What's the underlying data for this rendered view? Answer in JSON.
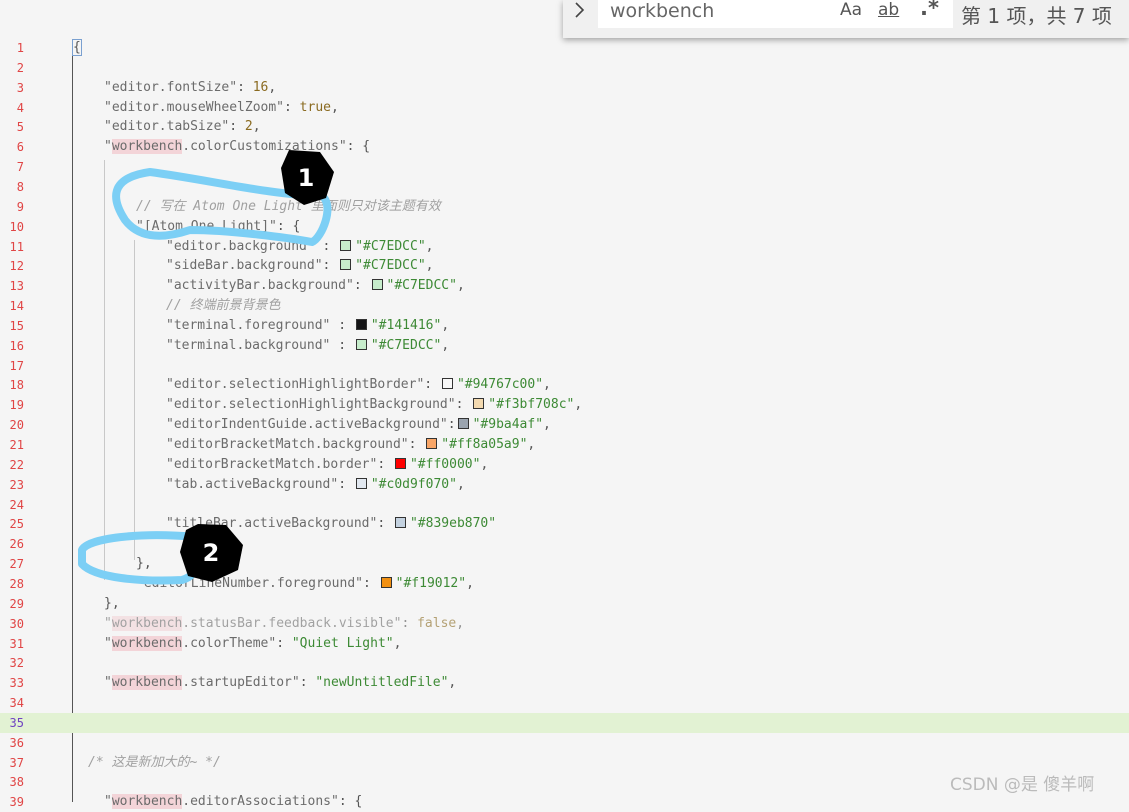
{
  "find": {
    "query": "workbench",
    "match_case_label": "Aa",
    "whole_word_label": "ab",
    "regex_label": ".*",
    "match_count": "第 1 项，共 7 项"
  },
  "annotations": [
    "1",
    "2"
  ],
  "watermark": "CSDN @是 傻羊啊",
  "lines": [
    {
      "n": "1",
      "indent": 72,
      "tokens": [
        {
          "t": "{",
          "c": "pun bracket"
        }
      ]
    },
    {
      "n": "2",
      "indent": 104,
      "tokens": []
    },
    {
      "n": "3",
      "indent": 104,
      "tokens": [
        {
          "t": "\"editor.fontSize\"",
          "c": "key"
        },
        {
          "t": ": ",
          "c": "pun"
        },
        {
          "t": "16",
          "c": "num"
        },
        {
          "t": ",",
          "c": "pun"
        }
      ]
    },
    {
      "n": "4",
      "indent": 104,
      "tokens": [
        {
          "t": "\"editor.mouseWheelZoom\"",
          "c": "key"
        },
        {
          "t": ": ",
          "c": "pun"
        },
        {
          "t": "true",
          "c": "num"
        },
        {
          "t": ",",
          "c": "pun"
        }
      ]
    },
    {
      "n": "5",
      "indent": 104,
      "tokens": [
        {
          "t": "\"editor.tabSize\"",
          "c": "key"
        },
        {
          "t": ": ",
          "c": "pun"
        },
        {
          "t": "2",
          "c": "num"
        },
        {
          "t": ",",
          "c": "pun"
        }
      ]
    },
    {
      "n": "6",
      "indent": 104,
      "tokens": [
        {
          "t": "\"",
          "c": "key"
        },
        {
          "t": "workbench",
          "c": "key hl"
        },
        {
          "t": ".colorCustomizations\"",
          "c": "key"
        },
        {
          "t": ": {",
          "c": "pun"
        }
      ]
    },
    {
      "n": "7",
      "indent": 104,
      "tokens": []
    },
    {
      "n": "8",
      "indent": 104,
      "tokens": []
    },
    {
      "n": "9",
      "indent": 136,
      "tokens": [
        {
          "t": "// 写在 Atom One Light 里面则只对该主题有效",
          "c": "com"
        }
      ]
    },
    {
      "n": "10",
      "indent": 136,
      "tokens": [
        {
          "t": "\"[Atom One Light]\"",
          "c": "key"
        },
        {
          "t": ": {",
          "c": "pun"
        }
      ]
    },
    {
      "n": "11",
      "indent": 166,
      "tokens": [
        {
          "t": "\"editor.background\"",
          "c": "key"
        },
        {
          "t": " : ",
          "c": "pun"
        },
        {
          "sw": "#C7EDCC"
        },
        {
          "t": "\"#C7EDCC\"",
          "c": "str"
        },
        {
          "t": ",",
          "c": "pun"
        }
      ]
    },
    {
      "n": "12",
      "indent": 166,
      "tokens": [
        {
          "t": "\"sideBar.background\"",
          "c": "key"
        },
        {
          "t": ": ",
          "c": "pun"
        },
        {
          "sw": "#C7EDCC"
        },
        {
          "t": "\"#C7EDCC\"",
          "c": "str"
        },
        {
          "t": ",",
          "c": "pun"
        }
      ]
    },
    {
      "n": "13",
      "indent": 166,
      "tokens": [
        {
          "t": "\"activityBar.background\"",
          "c": "key"
        },
        {
          "t": ": ",
          "c": "pun"
        },
        {
          "sw": "#C7EDCC"
        },
        {
          "t": "\"#C7EDCC\"",
          "c": "str"
        },
        {
          "t": ",",
          "c": "pun"
        }
      ]
    },
    {
      "n": "14",
      "indent": 166,
      "tokens": [
        {
          "t": "// 终端前景背景色",
          "c": "com"
        }
      ]
    },
    {
      "n": "15",
      "indent": 166,
      "tokens": [
        {
          "t": "\"terminal.foreground\"",
          "c": "key"
        },
        {
          "t": " : ",
          "c": "pun"
        },
        {
          "sw": "#141416"
        },
        {
          "t": "\"#141416\"",
          "c": "str"
        },
        {
          "t": ",",
          "c": "pun"
        }
      ]
    },
    {
      "n": "16",
      "indent": 166,
      "tokens": [
        {
          "t": "\"terminal.background\"",
          "c": "key"
        },
        {
          "t": " : ",
          "c": "pun"
        },
        {
          "sw": "#C7EDCC"
        },
        {
          "t": "\"#C7EDCC\"",
          "c": "str"
        },
        {
          "t": ",",
          "c": "pun"
        }
      ]
    },
    {
      "n": "17",
      "indent": 166,
      "tokens": []
    },
    {
      "n": "18",
      "indent": 166,
      "tokens": [
        {
          "t": "\"editor.selectionHighlightBorder\"",
          "c": "key"
        },
        {
          "t": ": ",
          "c": "pun"
        },
        {
          "sw": "#f8f8f8"
        },
        {
          "t": "\"#94767c00\"",
          "c": "str"
        },
        {
          "t": ",",
          "c": "pun"
        }
      ]
    },
    {
      "n": "19",
      "indent": 166,
      "tokens": [
        {
          "t": "\"editor.selectionHighlightBackground\"",
          "c": "key"
        },
        {
          "t": ": ",
          "c": "pun"
        },
        {
          "sw": "#f3d9b0"
        },
        {
          "t": "\"#f3bf708c\"",
          "c": "str"
        },
        {
          "t": ",",
          "c": "pun"
        }
      ]
    },
    {
      "n": "20",
      "indent": 166,
      "tokens": [
        {
          "t": "\"editorIndentGuide.activeBackground\"",
          "c": "key"
        },
        {
          "t": ":",
          "c": "pun"
        },
        {
          "sw": "#9ba4af"
        },
        {
          "t": "\"#9ba4af\"",
          "c": "str"
        },
        {
          "t": ",",
          "c": "pun"
        }
      ]
    },
    {
      "n": "21",
      "indent": 166,
      "tokens": [
        {
          "t": "\"editorBracketMatch.background\"",
          "c": "key"
        },
        {
          "t": ": ",
          "c": "pun"
        },
        {
          "sw": "#f9a668"
        },
        {
          "t": "\"#ff8a05a9\"",
          "c": "str"
        },
        {
          "t": ",",
          "c": "pun"
        }
      ]
    },
    {
      "n": "22",
      "indent": 166,
      "tokens": [
        {
          "t": "\"editorBracketMatch.border\"",
          "c": "key"
        },
        {
          "t": ": ",
          "c": "pun"
        },
        {
          "sw": "#ff0000"
        },
        {
          "t": "\"#ff0000\"",
          "c": "str"
        },
        {
          "t": ",",
          "c": "pun"
        }
      ]
    },
    {
      "n": "23",
      "indent": 166,
      "tokens": [
        {
          "t": "\"tab.activeBackground\"",
          "c": "key"
        },
        {
          "t": ": ",
          "c": "pun"
        },
        {
          "sw": "#e2e8f0"
        },
        {
          "t": "\"#c0d9f070\"",
          "c": "str"
        },
        {
          "t": ",",
          "c": "pun"
        }
      ]
    },
    {
      "n": "24",
      "indent": 166,
      "tokens": []
    },
    {
      "n": "25",
      "indent": 166,
      "tokens": [
        {
          "t": "\"titleBar.activeBackground\"",
          "c": "key"
        },
        {
          "t": ": ",
          "c": "pun"
        },
        {
          "sw": "#c4d2e0"
        },
        {
          "t": "\"#839eb870\"",
          "c": "str"
        }
      ]
    },
    {
      "n": "26",
      "indent": 166,
      "tokens": []
    },
    {
      "n": "27",
      "indent": 136,
      "tokens": [
        {
          "t": "},",
          "c": "pun"
        }
      ]
    },
    {
      "n": "28",
      "indent": 136,
      "tokens": [
        {
          "t": "\"editorLineNumber.foreground\"",
          "c": "key"
        },
        {
          "t": ": ",
          "c": "pun"
        },
        {
          "sw": "#f19012"
        },
        {
          "t": "\"#f19012\"",
          "c": "str"
        },
        {
          "t": ",",
          "c": "pun"
        }
      ]
    },
    {
      "n": "29",
      "indent": 104,
      "tokens": [
        {
          "t": "},",
          "c": "pun"
        }
      ]
    },
    {
      "n": "30",
      "indent": 104,
      "faded": true,
      "tokens": [
        {
          "t": "\"",
          "c": "key"
        },
        {
          "t": "workbench",
          "c": "key hl"
        },
        {
          "t": ".statusBar.feedback.visible\"",
          "c": "key"
        },
        {
          "t": ": ",
          "c": "pun"
        },
        {
          "t": "false",
          "c": "num"
        },
        {
          "t": ",",
          "c": "pun"
        }
      ]
    },
    {
      "n": "31",
      "indent": 104,
      "tokens": [
        {
          "t": "\"",
          "c": "key"
        },
        {
          "t": "workbench",
          "c": "key hl"
        },
        {
          "t": ".colorTheme\"",
          "c": "key"
        },
        {
          "t": ": ",
          "c": "pun"
        },
        {
          "t": "\"Quiet Light\"",
          "c": "str"
        },
        {
          "t": ",",
          "c": "pun"
        }
      ]
    },
    {
      "n": "32",
      "indent": 104,
      "tokens": []
    },
    {
      "n": "33",
      "indent": 104,
      "tokens": [
        {
          "t": "\"",
          "c": "key"
        },
        {
          "t": "workbench",
          "c": "key hl"
        },
        {
          "t": ".startupEditor\"",
          "c": "key"
        },
        {
          "t": ": ",
          "c": "pun"
        },
        {
          "t": "\"newUntitledFile\"",
          "c": "str"
        },
        {
          "t": ",",
          "c": "pun"
        }
      ]
    },
    {
      "n": "34",
      "indent": 104,
      "tokens": []
    },
    {
      "n": "35",
      "indent": 104,
      "current": true,
      "tokens": []
    },
    {
      "n": "36",
      "indent": 104,
      "tokens": []
    },
    {
      "n": "37",
      "indent": 88,
      "tokens": [
        {
          "t": "/* 这是新加大的~ */",
          "c": "com"
        }
      ]
    },
    {
      "n": "38",
      "indent": 104,
      "tokens": []
    },
    {
      "n": "39",
      "indent": 104,
      "tokens": [
        {
          "t": "\"",
          "c": "key"
        },
        {
          "t": "workbench",
          "c": "key hl"
        },
        {
          "t": ".editorAssociations\"",
          "c": "key"
        },
        {
          "t": ": {",
          "c": "pun"
        }
      ]
    }
  ]
}
